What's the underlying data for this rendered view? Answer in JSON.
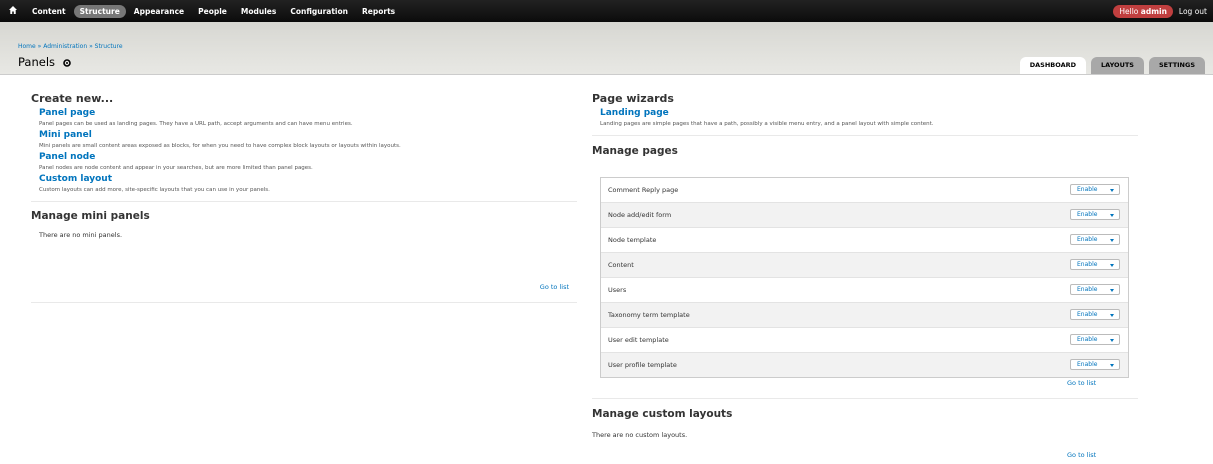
{
  "toolbar": {
    "menu": [
      "Content",
      "Structure",
      "Appearance",
      "People",
      "Modules",
      "Configuration",
      "Reports"
    ],
    "active": "Structure",
    "hello_prefix": "Hello",
    "username": "admin",
    "logout": "Log out"
  },
  "header": {
    "breadcrumb": [
      "Home",
      "Administration",
      "Structure"
    ],
    "breadcrumb_separator": "»",
    "title": "Panels",
    "tabs": [
      "DASHBOARD",
      "LAYOUTS",
      "SETTINGS"
    ],
    "active_tab": "DASHBOARD"
  },
  "create_new": {
    "heading": "Create new...",
    "items": [
      {
        "title": "Panel page",
        "desc": "Panel pages can be used as landing pages. They have a URL path, accept arguments and can have menu entries."
      },
      {
        "title": "Mini panel",
        "desc": "Mini panels are small content areas exposed as blocks, for when you need to have complex block layouts or layouts within layouts."
      },
      {
        "title": "Panel node",
        "desc": "Panel nodes are node content and appear in your searches, but are more limited than panel pages."
      },
      {
        "title": "Custom layout",
        "desc": "Custom layouts can add more, site-specific layouts that you can use in your panels."
      }
    ]
  },
  "mini_panels": {
    "heading": "Manage mini panels",
    "empty": "There are no mini panels.",
    "goto": "Go to list"
  },
  "page_wizards": {
    "heading": "Page wizards",
    "title": "Landing page",
    "desc": "Landing pages are simple pages that have a path, possibly a visible menu entry, and a panel layout with simple content."
  },
  "manage_pages": {
    "heading": "Manage pages",
    "button_label": "Enable",
    "rows": [
      "Comment Reply page",
      "Node add/edit form",
      "Node template",
      "Content",
      "Users",
      "Taxonomy term template",
      "User edit template",
      "User profile template"
    ],
    "goto": "Go to list"
  },
  "custom_layouts": {
    "heading": "Manage custom layouts",
    "empty": "There are no custom layouts.",
    "goto": "Go to list"
  },
  "colors": {
    "link": "#0074bd",
    "hello_badge": "#c03f3f",
    "toolbar_bg": "#111111",
    "active_menu": "#777777"
  }
}
